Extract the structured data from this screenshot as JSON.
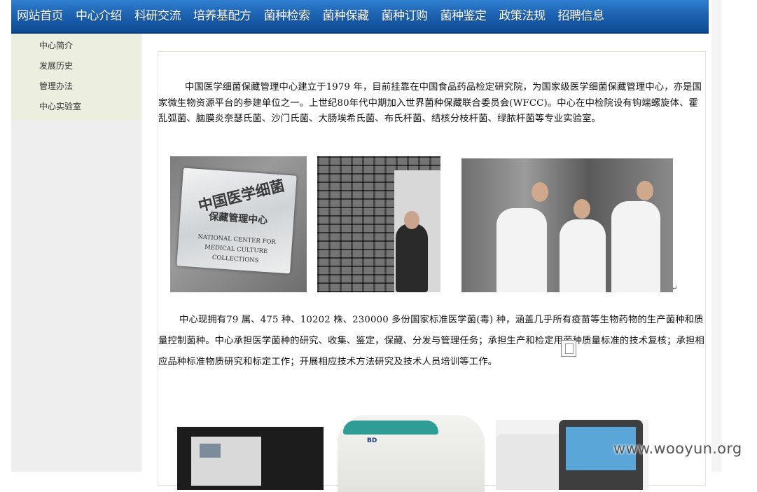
{
  "nav": {
    "items": [
      "网站首页",
      "中心介绍",
      "科研交流",
      "培养基配方",
      "菌种检索",
      "菌种保藏",
      "菌种订购",
      "菌种鉴定",
      "政策法规",
      "招聘信息"
    ]
  },
  "sidebar": {
    "items": [
      "中心简介",
      "发展历史",
      "管理办法",
      "中心实验室"
    ]
  },
  "content": {
    "paragraph1": "中国医学细菌保藏管理中心建立于1979 年，目前挂靠在中国食品药品检定研究院，为国家级医学细菌保藏管理中心，亦是国家微生物资源平台的参建单位之一。上世纪80年代中期加入世界菌种保藏联合委员会(WFCC)。中心在中检院设有钩端螺旋体、霍乱弧菌、脑膜炎奈瑟氏菌、沙门氏菌、大肠埃希氏菌、布氏杆菌、结核分枝杆菌、绿脓杆菌等专业实验室。",
    "paragraph2": "中心现拥有79 属、475 种、10202 株、230000 多份国家标准医学菌(毒) 种，涵盖几乎所有疫苗等生物药物的生产菌种和质量控制菌种。中心承担医学菌种的研究、收集、鉴定，保藏、分发与管理任务；承担生产和检定用菌种质量标准的技术复核；承担相应品种标准物质研究和标定工作；开展相应技术方法研究及技术人员培训等工作。",
    "paragraph_mark": "↵",
    "sign_photo": {
      "cn_line1": "中国医学细菌",
      "cn_line2": "保藏管理中心",
      "en_line1": "NATIONAL CENTER FOR",
      "en_line2": "MEDICAL CULTURE COLLECTIONS"
    },
    "instrument_logo": "BD"
  },
  "watermark": "www.wooyun.org"
}
